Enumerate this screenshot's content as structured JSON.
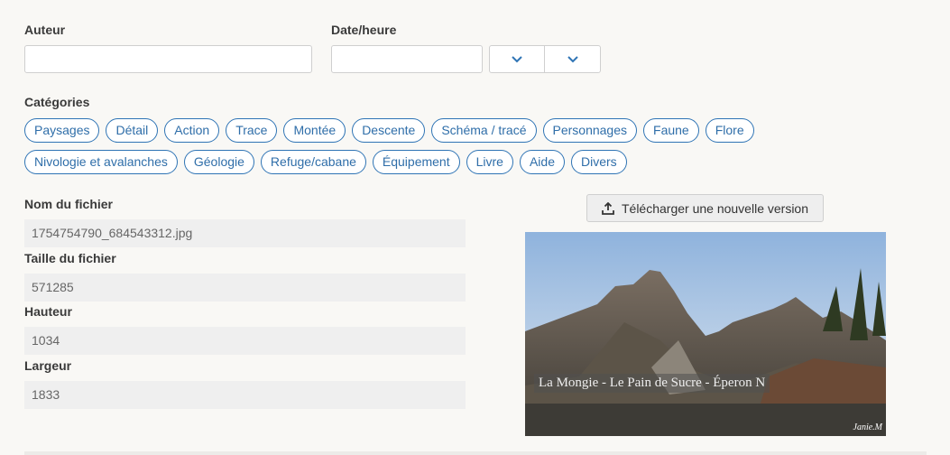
{
  "auteur": {
    "label": "Auteur",
    "value": ""
  },
  "date": {
    "label": "Date/heure",
    "value": ""
  },
  "categories": {
    "label": "Catégories",
    "row1": [
      "Paysages",
      "Détail",
      "Action",
      "Trace",
      "Montée",
      "Descente",
      "Schéma / tracé",
      "Personnages",
      "Faune",
      "Flore"
    ],
    "row2": [
      "Nivologie et avalanches",
      "Géologie",
      "Refuge/cabane",
      "Équipement",
      "Livre",
      "Aide",
      "Divers"
    ]
  },
  "file": {
    "name_label": "Nom du fichier",
    "name": "1754754790_684543312.jpg",
    "size_label": "Taille du fichier",
    "size": "571285",
    "height_label": "Hauteur",
    "height": "1034",
    "width_label": "Largeur",
    "width": "1833"
  },
  "upload_button": "Télécharger une nouvelle version",
  "photo": {
    "caption": "La Mongie - Le Pain de Sucre - Éperon N",
    "signature": "Janie.M"
  },
  "colors": {
    "accent": "#2f74b5",
    "background": "#f9f8f5"
  },
  "icons": {
    "select": "chevron-down-icon",
    "upload": "upload-icon"
  }
}
